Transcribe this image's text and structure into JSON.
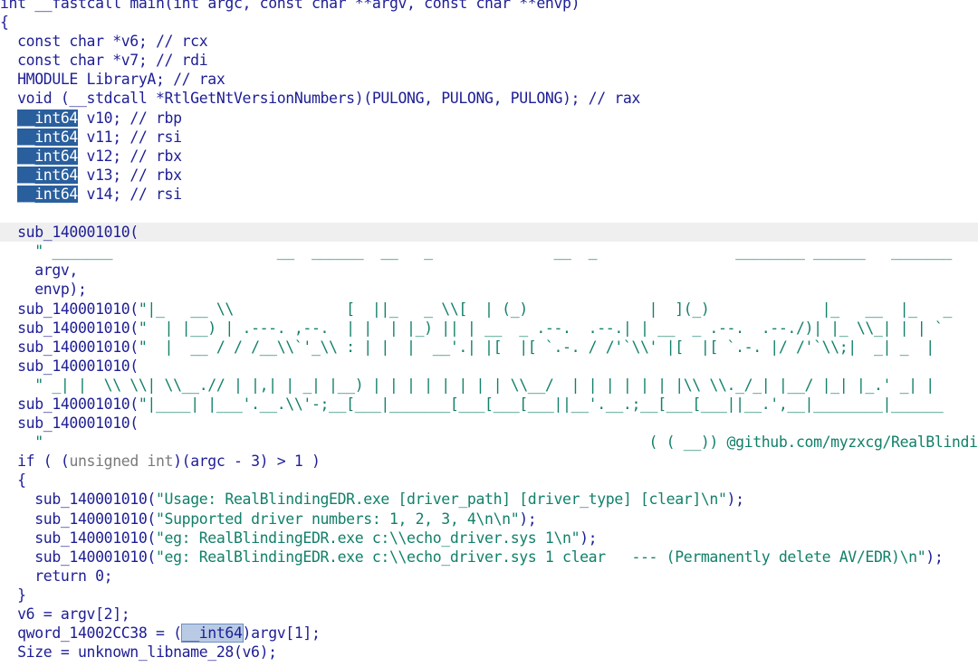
{
  "colors": {
    "background": "#ffffff",
    "text": "#1e1e96",
    "string": "#12806a",
    "dim": "#7a7a7a",
    "selection": "#2a5f9e",
    "highlight_secondary": "#b9cbe4",
    "current_line": "#efefef"
  },
  "lines": [
    {
      "spans": [
        {
          "t": "int",
          "c": "kw"
        },
        {
          "t": " __fastcall main(",
          "c": "id"
        },
        {
          "t": "int",
          "c": "kw"
        },
        {
          "t": " argc, const char **argv, const char **envp)",
          "c": "id"
        }
      ]
    },
    {
      "spans": [
        {
          "t": "{",
          "c": "pu"
        }
      ]
    },
    {
      "spans": [
        {
          "t": "  const char *v6; // rcx",
          "c": "id"
        }
      ]
    },
    {
      "spans": [
        {
          "t": "  const char *v7; // rdi",
          "c": "id"
        }
      ]
    },
    {
      "spans": [
        {
          "t": "  HMODULE LibraryA; // rax",
          "c": "id"
        }
      ]
    },
    {
      "spans": [
        {
          "t": "  void (__stdcall *RtlGetNtVersionNumbers)(PULONG, PULONG, PULONG); // rax",
          "c": "id"
        }
      ]
    },
    {
      "spans": [
        {
          "t": "  ",
          "c": "id"
        },
        {
          "t": "__int64",
          "c": "hl"
        },
        {
          "t": " v10; // rbp",
          "c": "id"
        }
      ]
    },
    {
      "spans": [
        {
          "t": "  ",
          "c": "id"
        },
        {
          "t": "__int64",
          "c": "hl"
        },
        {
          "t": " v11; // rsi",
          "c": "id"
        }
      ]
    },
    {
      "spans": [
        {
          "t": "  ",
          "c": "id"
        },
        {
          "t": "__int64",
          "c": "hl"
        },
        {
          "t": " v12; // rbx",
          "c": "id"
        }
      ]
    },
    {
      "spans": [
        {
          "t": "  ",
          "c": "id"
        },
        {
          "t": "__int64",
          "c": "hl"
        },
        {
          "t": " v13; // rbx",
          "c": "id"
        }
      ]
    },
    {
      "spans": [
        {
          "t": "  ",
          "c": "id"
        },
        {
          "t": "__int64",
          "c": "hl"
        },
        {
          "t": " v14; // rsi",
          "c": "id"
        }
      ]
    },
    {
      "spans": [
        {
          "t": " ",
          "c": "id"
        }
      ]
    },
    {
      "current": true,
      "spans": [
        {
          "t": "  sub_140001010(",
          "c": "id"
        }
      ]
    },
    {
      "spans": [
        {
          "t": "    \" _______                   __  ______  __   _              __  _                ________ ______   _______",
          "c": "str"
        }
      ]
    },
    {
      "spans": [
        {
          "t": "    argv,",
          "c": "id"
        }
      ]
    },
    {
      "spans": [
        {
          "t": "    envp);",
          "c": "id"
        }
      ]
    },
    {
      "spans": [
        {
          "t": "  sub_140001010(",
          "c": "id"
        },
        {
          "t": "\"|_   __ \\\\             [  ||_   _ \\\\[  | (_)              |  ](_)             |_   __  |_   _",
          "c": "str"
        }
      ]
    },
    {
      "spans": [
        {
          "t": "  sub_140001010(",
          "c": "id"
        },
        {
          "t": "\"  | |__) | .---. ,--.  | |  | |_) || | __  _ .--.  .--.| | __  _ .--.  .--./)| |_ \\\\_| | | `",
          "c": "str"
        }
      ]
    },
    {
      "spans": [
        {
          "t": "  sub_140001010(",
          "c": "id"
        },
        {
          "t": "\"  |  __ / / /__\\\\`'_\\\\ : | |  |  __'.| |[  |[ `.-. / /'`\\\\' |[  |[ `.-. |/ /'`\\\\;|  _| _  |",
          "c": "str"
        }
      ]
    },
    {
      "spans": [
        {
          "t": "  sub_140001010(",
          "c": "id"
        }
      ]
    },
    {
      "spans": [
        {
          "t": "    \" _| |  \\\\ \\\\| \\\\__.// | |,| | _| |__) | | | | | | | | \\\\__/  | | | | | | |\\\\ \\\\._/_| |__/ |_| |_.' _| |",
          "c": "str"
        }
      ]
    },
    {
      "spans": [
        {
          "t": "  sub_140001010(",
          "c": "id"
        },
        {
          "t": "\"|____| |___'.__.\\\\'-;__[___|_______[___[___[___||__'.__.;__[___[___||__.',__|________|______",
          "c": "str"
        }
      ]
    },
    {
      "spans": [
        {
          "t": "  sub_140001010(",
          "c": "id"
        }
      ]
    },
    {
      "spans": [
        {
          "t": "    \"",
          "c": "str"
        },
        {
          "t": "                                                                      ( ( __)) @github.com/myzxcg/RealBlindingEDR",
          "c": "str"
        }
      ]
    },
    {
      "spans": [
        {
          "t": "  if ( (",
          "c": "kw"
        },
        {
          "t": "unsigned int",
          "c": "dim"
        },
        {
          "t": ")(argc - 3) > 1 )",
          "c": "id"
        }
      ]
    },
    {
      "spans": [
        {
          "t": "  {",
          "c": "pu"
        }
      ]
    },
    {
      "spans": [
        {
          "t": "    sub_140001010(",
          "c": "id"
        },
        {
          "t": "\"Usage: RealBlindingEDR.exe [driver_path] [driver_type] [clear]\\n\"",
          "c": "str"
        },
        {
          "t": ");",
          "c": "id"
        }
      ]
    },
    {
      "spans": [
        {
          "t": "    sub_140001010(",
          "c": "id"
        },
        {
          "t": "\"Supported driver numbers: 1, 2, 3, 4\\n\\n\"",
          "c": "str"
        },
        {
          "t": ");",
          "c": "id"
        }
      ]
    },
    {
      "spans": [
        {
          "t": "    sub_140001010(",
          "c": "id"
        },
        {
          "t": "\"eg: RealBlindingEDR.exe c:\\\\echo_driver.sys 1\\n\"",
          "c": "str"
        },
        {
          "t": ");",
          "c": "id"
        }
      ]
    },
    {
      "spans": [
        {
          "t": "    sub_140001010(",
          "c": "id"
        },
        {
          "t": "\"eg: RealBlindingEDR.exe c:\\\\echo_driver.sys 1 clear   --- (Permanently delete AV/EDR)\\n\"",
          "c": "str"
        },
        {
          "t": ");",
          "c": "id"
        }
      ]
    },
    {
      "spans": [
        {
          "t": "    return 0;",
          "c": "kw"
        }
      ]
    },
    {
      "spans": [
        {
          "t": "  }",
          "c": "pu"
        }
      ]
    },
    {
      "spans": [
        {
          "t": "  v6 = argv[2];",
          "c": "id"
        }
      ]
    },
    {
      "spans": [
        {
          "t": "  qword_14002CC38 = (",
          "c": "id"
        },
        {
          "t": "__int64",
          "c": "hl2"
        },
        {
          "t": ")argv[1];",
          "c": "id"
        }
      ]
    },
    {
      "spans": [
        {
          "t": "  Size = unknown_libname_28(v6);",
          "c": "id"
        }
      ]
    }
  ]
}
